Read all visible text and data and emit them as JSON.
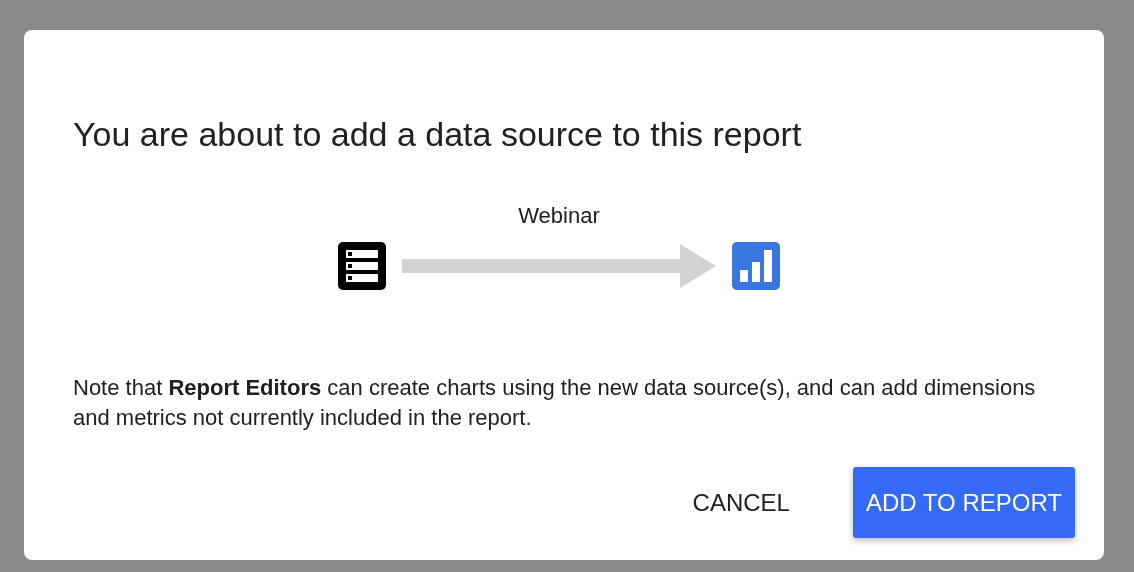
{
  "dialog": {
    "title": "You are about to add a data source to this report",
    "flow": {
      "label": "Webinar"
    },
    "note": "Note that **Report Editors** can create charts using the new data source(s), and can add dimensions and metrics not currently included in the report.",
    "buttons": [
      {
        "label": "CANCEL",
        "kind": "text"
      },
      {
        "label": "ADD TO REPORT",
        "kind": "primary"
      }
    ]
  }
}
